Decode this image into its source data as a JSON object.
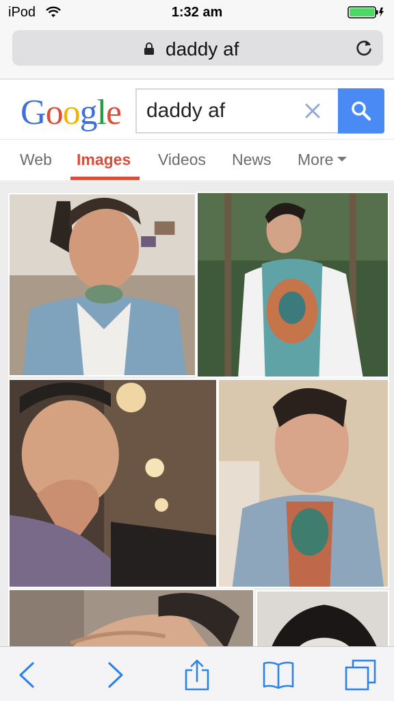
{
  "status_bar": {
    "device": "iPod",
    "time": "1:32 am"
  },
  "address_bar": {
    "url": "daddy af"
  },
  "google": {
    "logo_letters": [
      {
        "char": "G",
        "color": "#3f6fd9"
      },
      {
        "char": "o",
        "color": "#dd4b39"
      },
      {
        "char": "o",
        "color": "#f2b400"
      },
      {
        "char": "g",
        "color": "#3f6fd9"
      },
      {
        "char": "l",
        "color": "#249a41"
      },
      {
        "char": "e",
        "color": "#dd4b39"
      }
    ],
    "search_query": "daddy af"
  },
  "tabs": [
    {
      "label": "Web",
      "active": false
    },
    {
      "label": "Images",
      "active": true
    },
    {
      "label": "Videos",
      "active": false
    },
    {
      "label": "News",
      "active": false
    },
    {
      "label": "More",
      "active": false
    }
  ],
  "image_results": [
    {
      "name": "result-1",
      "tone": "#b6a99a"
    },
    {
      "name": "result-2",
      "tone": "#3f5a3a"
    },
    {
      "name": "result-3",
      "tone": "#5a4a3c"
    },
    {
      "name": "result-4",
      "tone": "#c9b99f"
    },
    {
      "name": "result-5",
      "tone": "#9c8c7e"
    },
    {
      "name": "result-6",
      "tone": "#d8d4d0"
    }
  ],
  "toolbar": {
    "icons": [
      "back-icon",
      "forward-icon",
      "share-icon",
      "bookmarks-icon",
      "tabs-icon"
    ]
  },
  "colors": {
    "ios_blue": "#2a83e8",
    "google_blue_button": "#4a8af4",
    "active_tab": "#dd4b39",
    "battery": "#4cd964"
  }
}
